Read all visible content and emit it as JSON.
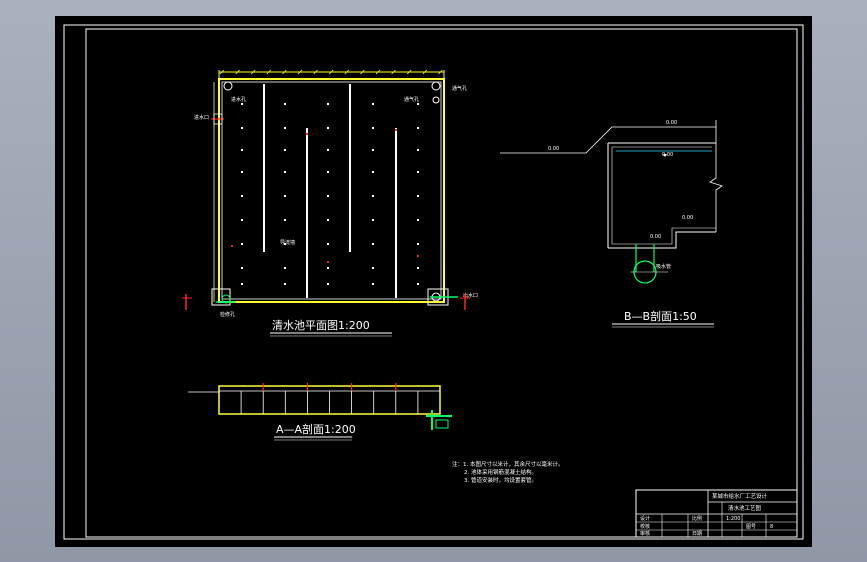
{
  "colors": {
    "background": "#000000",
    "frame": "#ffffff",
    "wall": "#ffff33",
    "wall_inner": "#ffffff",
    "dimension": "#ffff33",
    "section_cut": "#ff2222",
    "pipe": "#00ff66",
    "water": "#22ddff",
    "text": "#ffffff"
  },
  "plan": {
    "title": "清水池平面图1:200",
    "label_top_left": "进水孔",
    "label_top_right": "通气孔",
    "label_inlet": "进水口",
    "label_center": "导流墙",
    "label_bottom_left": "检修孔",
    "label_outlet": "出水口",
    "label_vent_right": "通气孔"
  },
  "section_a": {
    "title": "A—A剖面1:200"
  },
  "section_b": {
    "title": "B—B剖面1:50",
    "level_ground": "0.00",
    "level_top": "0.00",
    "level_water": "0.00",
    "level_mid": "0.00",
    "level_bottom": "0.00",
    "pipe_label": "吸水管"
  },
  "notes": {
    "line1": "注：1. 本图尺寸以米计，其余尺寸以毫米计。",
    "line2": "2. 池体采用钢筋混凝土结构。",
    "line3": "3. 管道安装时，均设置套管。"
  },
  "title_block": {
    "project": "某城市给水厂工艺设计",
    "drawing": "清水池工艺图",
    "role1": "设计",
    "role2": "校核",
    "role3": "审核",
    "label_scale": "比例",
    "label_sheet": "图号",
    "label_date": "日期",
    "scale": "1:200",
    "sheet_no": "8"
  }
}
